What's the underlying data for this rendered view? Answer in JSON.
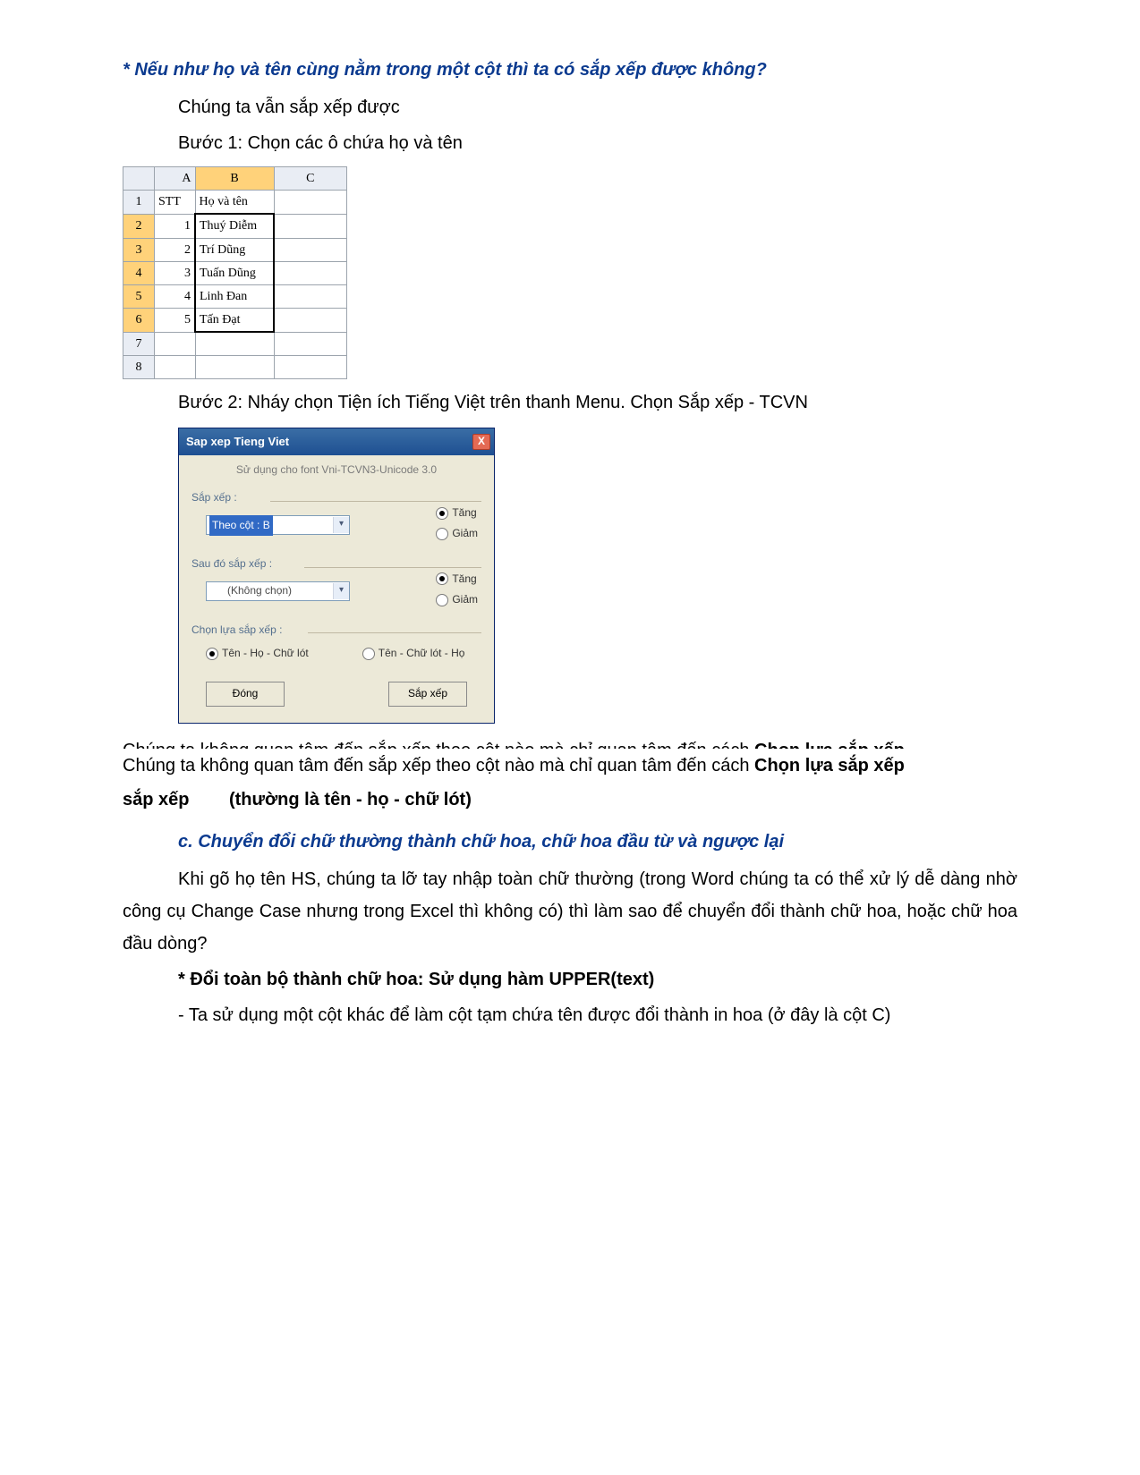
{
  "q1": "* Nếu như họ và tên cùng nằm trong một cột thì ta có sắp xếp được không?",
  "a1": "Chúng ta vẫn sắp xếp được",
  "step1": "Bước 1: Chọn các ô chứa họ và tên",
  "step2": "Bước 2: Nháy chọn Tiện ích Tiếng Việt trên thanh Menu. Chọn Sắp xếp - TCVN",
  "excel": {
    "cols": [
      "A",
      "B",
      "C"
    ],
    "rows": [
      {
        "n": "1",
        "a": "STT",
        "b": "Họ và tên",
        "c": ""
      },
      {
        "n": "2",
        "a": "1",
        "b": "Thuý Diễm",
        "c": ""
      },
      {
        "n": "3",
        "a": "2",
        "b": "Trí Dũng",
        "c": ""
      },
      {
        "n": "4",
        "a": "3",
        "b": "Tuấn Dũng",
        "c": ""
      },
      {
        "n": "5",
        "a": "4",
        "b": "Linh Đan",
        "c": ""
      },
      {
        "n": "6",
        "a": "5",
        "b": "Tấn Đạt",
        "c": ""
      },
      {
        "n": "7",
        "a": "",
        "b": "",
        "c": ""
      },
      {
        "n": "8",
        "a": "",
        "b": "",
        "c": ""
      }
    ]
  },
  "dlg": {
    "title": "Sap xep Tieng Viet",
    "sub": "Sử dụng cho font Vni-TCVN3-Unicode 3.0",
    "sapxep": "Sắp xếp :",
    "ddl1": "Theo cột : B",
    "tang": "Tăng",
    "giam": "Giảm",
    "saudo": "Sau đó sắp xếp :",
    "ddl2": "(Không chọn)",
    "chonlua": "Chọn lựa sắp xếp :",
    "opt1": "Tên - Họ - Chữ lót",
    "opt2": "Tên - Chữ lót - Họ",
    "btn_dong": "Đóng",
    "btn_sapxep": "Sắp xếp"
  },
  "p2a": "Chúng ta không quan tâm đến sắp xếp theo cột nào mà chỉ quan tâm đến cách ",
  "p2b": "Chọn lựa sắp xếp",
  "p2c": "(thường là tên - họ - chữ lót)",
  "sub_c": "c. Chuyển đổi chữ thường  thành chữ hoa, chữ hoa đầu từ và ngược lại",
  "p3": "Khi gõ họ tên HS, chúng ta lỡ tay nhập toàn chữ thường (trong Word chúng ta có thể xử lý dễ dàng nhờ công cụ Change Case nhưng trong Excel thì không có) thì làm sao để chuyển đổi thành chữ hoa, hoặc chữ hoa đầu dòng?",
  "p4": "* Đổi toàn bộ thành chữ hoa: Sử dụng hàm UPPER(text)",
  "p5": "- Ta sử dụng một cột khác để làm cột tạm chứa tên được đổi thành in hoa (ở đây là cột C)"
}
